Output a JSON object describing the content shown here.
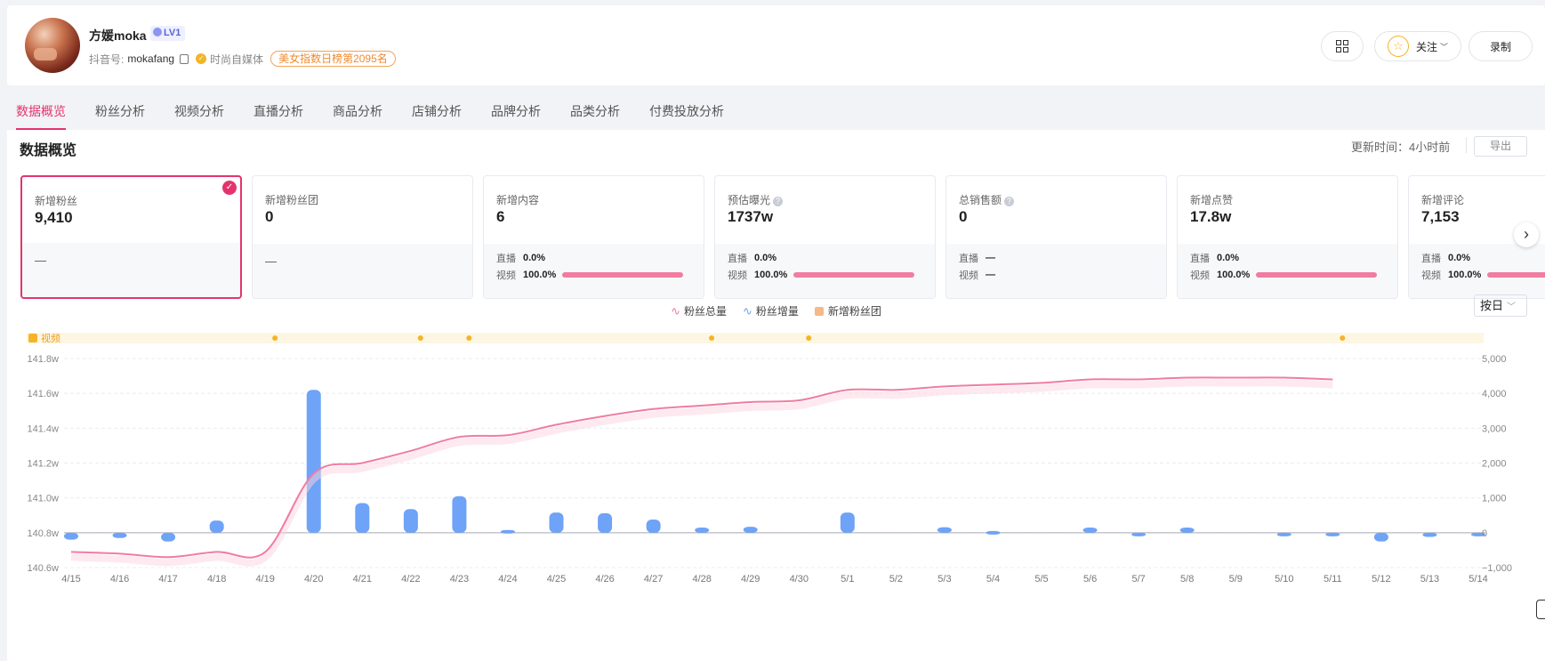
{
  "profile": {
    "name": "方媛moka",
    "level": "LV1",
    "id_label": "抖音号:",
    "id_value": "mokafang",
    "category": "时尚自媒体",
    "rank_badge": "美女指数日榜第2095名"
  },
  "header_buttons": {
    "follow": "关注",
    "record": "录制"
  },
  "tabs": [
    "数据概览",
    "粉丝分析",
    "视频分析",
    "直播分析",
    "商品分析",
    "店铺分析",
    "品牌分析",
    "品类分析",
    "付费投放分析"
  ],
  "section": {
    "title": "数据概览",
    "update_time": "更新时间：4小时前",
    "export": "导出"
  },
  "cards": [
    {
      "label": "新增粉丝",
      "value": "9,410",
      "dash": "—"
    },
    {
      "label": "新增粉丝团",
      "value": "0",
      "dash": "—"
    },
    {
      "label": "新增内容",
      "value": "6",
      "live_label": "直播",
      "live": "0.0%",
      "video_label": "视频",
      "video": "100.0%",
      "video_share": 1.0
    },
    {
      "label": "预估曝光",
      "value": "1737w",
      "live_label": "直播",
      "live": "0.0%",
      "video_label": "视频",
      "video": "100.0%",
      "video_share": 1.0
    },
    {
      "label": "总销售额",
      "value": "0",
      "live_label": "直播",
      "live": "—",
      "video_label": "视频",
      "video": "—"
    },
    {
      "label": "新增点赞",
      "value": "17.8w",
      "live_label": "直播",
      "live": "0.0%",
      "video_label": "视频",
      "video": "100.0%",
      "video_share": 1.0
    },
    {
      "label": "新增评论",
      "value": "7,153",
      "live_label": "直播",
      "live": "0.0%",
      "video_label": "视频",
      "video": "100.0%",
      "video_share": 1.0
    }
  ],
  "legend": {
    "total": "粉丝总量",
    "increase": "粉丝增量",
    "fan_club": "新增粉丝团"
  },
  "day_select": "按日",
  "colors": {
    "accent": "#e4346b",
    "line": "#f07da0",
    "bar": "#6ea3f7",
    "video_marker": "#f5b428"
  },
  "chart_data": {
    "type": "bar+line",
    "video_track_label": "视频",
    "video_markers": [
      "4/19",
      "4/22",
      "4/23",
      "4/28",
      "4/30",
      "5/11"
    ],
    "categories": [
      "4/15",
      "4/16",
      "4/17",
      "4/18",
      "4/19",
      "4/20",
      "4/21",
      "4/22",
      "4/23",
      "4/24",
      "4/25",
      "4/26",
      "4/27",
      "4/28",
      "4/29",
      "4/30",
      "5/1",
      "5/2",
      "5/3",
      "5/4",
      "5/5",
      "5/6",
      "5/7",
      "5/8",
      "5/9",
      "5/10",
      "5/11",
      "5/12",
      "5/13",
      "5/14"
    ],
    "series": [
      {
        "name": "粉丝总量",
        "axis": "left",
        "unit": "w",
        "values": [
          140.69,
          140.68,
          140.66,
          140.69,
          140.69,
          141.14,
          141.2,
          141.27,
          141.35,
          141.36,
          141.42,
          141.47,
          141.51,
          141.53,
          141.55,
          141.56,
          141.62,
          141.62,
          141.64,
          141.65,
          141.66,
          141.68,
          141.68,
          141.69,
          141.69,
          141.69,
          141.68,
          null,
          null,
          null
        ]
      },
      {
        "name": "粉丝增量",
        "axis": "right",
        "values": [
          -200,
          -150,
          -250,
          350,
          0,
          4100,
          850,
          680,
          1050,
          80,
          580,
          560,
          380,
          150,
          170,
          0,
          580,
          0,
          160,
          50,
          0,
          150,
          -100,
          150,
          0,
          -50,
          -100,
          -250,
          -120,
          -100
        ]
      }
    ],
    "left_axis_ticks": [
      "141.8w",
      "141.6w",
      "141.4w",
      "141.2w",
      "141.0w",
      "140.8w",
      "140.6w"
    ],
    "left_range": [
      140.6,
      141.8
    ],
    "right_axis_ticks": [
      "5,000",
      "4,000",
      "3,000",
      "2,000",
      "1,000",
      "0",
      "−1,000"
    ],
    "right_range": [
      -1000,
      5000
    ],
    "grid": true
  }
}
